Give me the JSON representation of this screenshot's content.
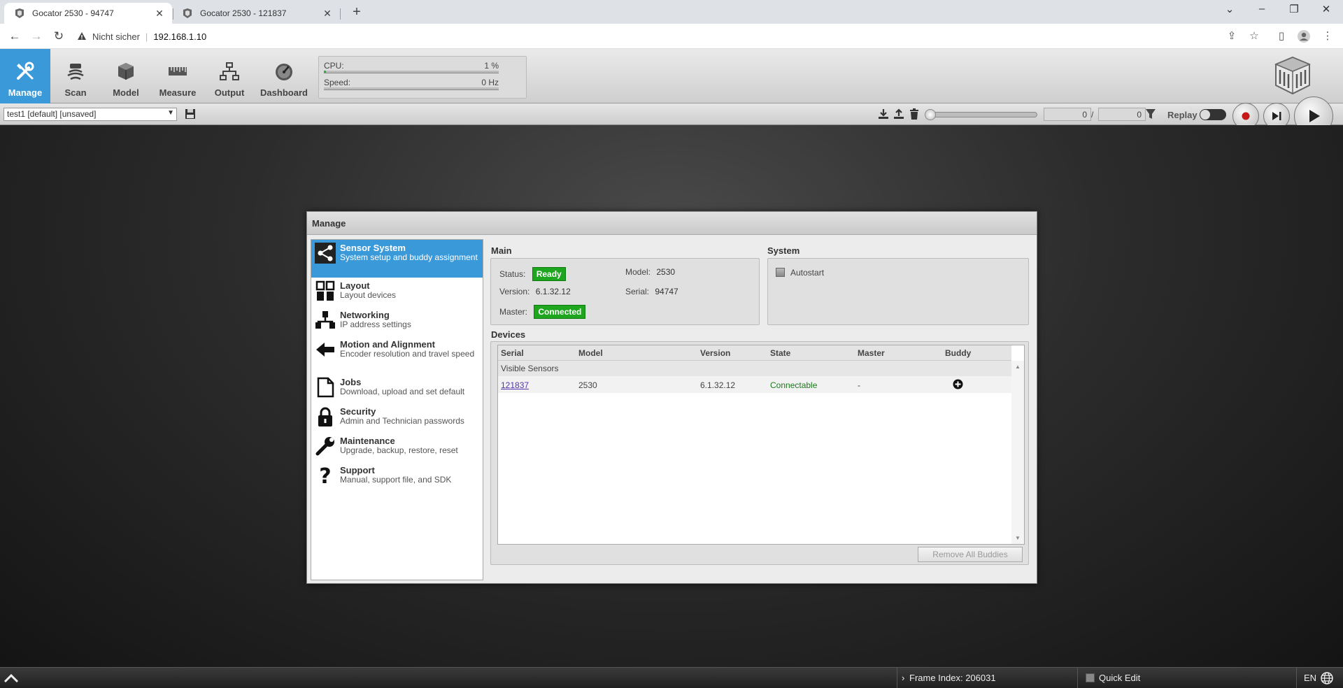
{
  "browser": {
    "tabs": [
      {
        "title": "Gocator 2530 - 94747",
        "active": true
      },
      {
        "title": "Gocator 2530 - 121837",
        "active": false
      }
    ],
    "security_label": "Nicht sicher",
    "url": "192.168.1.10"
  },
  "toolbar": {
    "nav": [
      {
        "label": "Manage",
        "icon": "tools-icon",
        "active": true
      },
      {
        "label": "Scan",
        "icon": "scan-icon"
      },
      {
        "label": "Model",
        "icon": "cubes-icon"
      },
      {
        "label": "Measure",
        "icon": "ruler-icon"
      },
      {
        "label": "Output",
        "icon": "network-icon"
      },
      {
        "label": "Dashboard",
        "icon": "gauge-icon"
      }
    ],
    "cpu_label": "CPU:",
    "cpu_value": "1 %",
    "cpu_fraction": 0.01,
    "speed_label": "Speed:",
    "speed_value": "0 Hz",
    "speed_fraction": 0
  },
  "subtoolbar": {
    "job": "test1 [default] [unsaved]",
    "frame_current": "0",
    "frame_total": "0",
    "separator": "/",
    "replay_label": "Replay"
  },
  "dialog": {
    "title": "Manage",
    "menu": [
      {
        "title": "Sensor System",
        "subtitle": "System setup and buddy assignment",
        "icon": "share-icon",
        "active": true
      },
      {
        "title": "Layout",
        "subtitle": "Layout devices",
        "icon": "layout-icon"
      },
      {
        "title": "Networking",
        "subtitle": "IP address settings",
        "icon": "networking-icon"
      },
      {
        "title": "Motion and Alignment",
        "subtitle": "Encoder resolution and travel speed",
        "icon": "arrow-left-icon"
      },
      {
        "title": "Jobs",
        "subtitle": "Download, upload and set default",
        "icon": "document-icon"
      },
      {
        "title": "Security",
        "subtitle": "Admin and Technician passwords",
        "icon": "lock-icon"
      },
      {
        "title": "Maintenance",
        "subtitle": "Upgrade, backup, restore, reset",
        "icon": "wrench-icon"
      },
      {
        "title": "Support",
        "subtitle": "Manual, support file, and SDK",
        "icon": "question-icon"
      }
    ],
    "main": {
      "heading": "Main",
      "status_label": "Status:",
      "status_value": "Ready",
      "version_label": "Version:",
      "version_value": "6.1.32.12",
      "master_label": "Master:",
      "master_value": "Connected",
      "model_label": "Model:",
      "model_value": "2530",
      "serial_label": "Serial:",
      "serial_value": "94747"
    },
    "system": {
      "heading": "System",
      "autostart_label": "Autostart"
    },
    "devices": {
      "heading": "Devices",
      "columns": [
        "Serial",
        "Model",
        "Version",
        "State",
        "Master",
        "Buddy"
      ],
      "group_label": "Visible Sensors",
      "rows": [
        {
          "serial": "121837",
          "model": "2530",
          "version": "6.1.32.12",
          "state": "Connectable",
          "master": "-"
        }
      ],
      "remove_all_label": "Remove All Buddies"
    }
  },
  "statusbar": {
    "frame_index": "Frame Index: 206031",
    "quick_edit": "Quick Edit",
    "language": "EN"
  },
  "colors": {
    "accent": "#3a9ad9",
    "ready_green": "#1fa61f",
    "connectable_green": "#1b7a1b"
  }
}
